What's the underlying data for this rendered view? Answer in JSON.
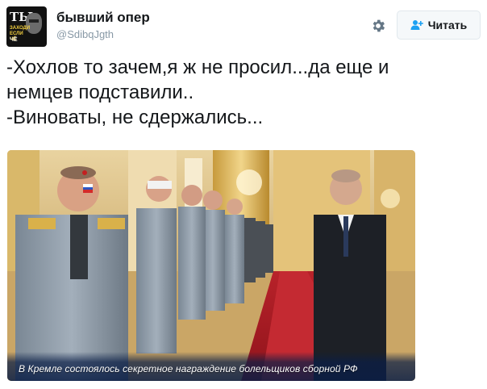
{
  "author": {
    "display_name": "бывший опер",
    "handle": "@SdibqJgth",
    "avatar": {
      "top_text": "ТЫ",
      "sub_text": "ЗАХОДИ ЕСЛИ ЧЁ",
      "bottom_text": "ЧЁ"
    }
  },
  "actions": {
    "settings_icon": "gear-icon",
    "follow_label": "Читать",
    "follow_icon": "add-user-icon"
  },
  "tweet": {
    "lines": [
      "-Хохлов то зачем,я ж не просил...да еще и",
      "немцев подставили..",
      "-Виноваты, не сдержались..."
    ]
  },
  "media": {
    "caption": "В Кремле состоялось секретное награждение болельщиков сборной РФ"
  },
  "colors": {
    "text": "#14171a",
    "secondary": "#8899a6",
    "button_bg": "#f5f8fa",
    "button_border": "#e1e8ed",
    "icon": "#1da1f2"
  }
}
